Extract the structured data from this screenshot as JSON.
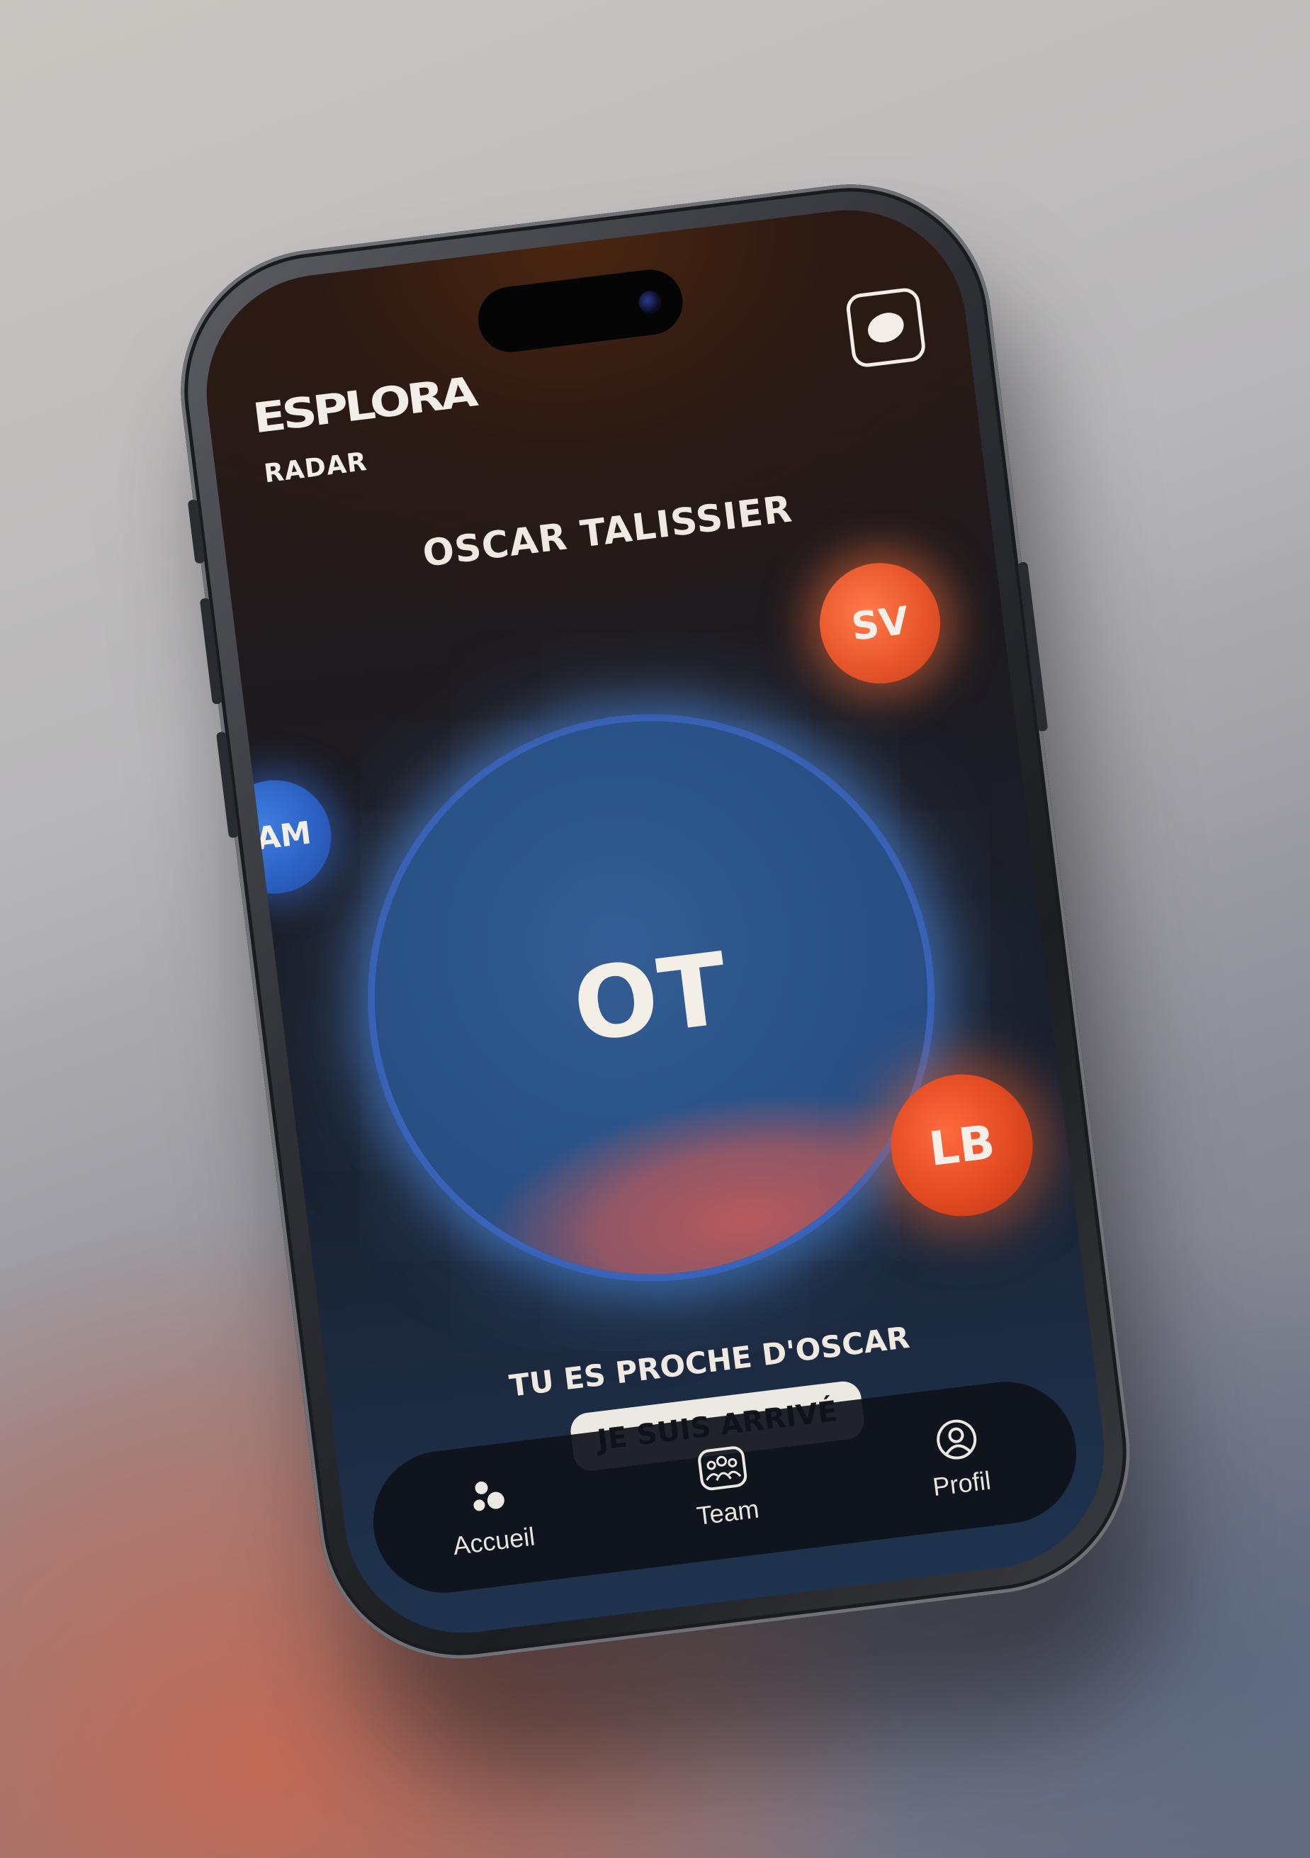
{
  "app": {
    "logo": "ESPLORA",
    "section": "RADAR"
  },
  "radar": {
    "person_name": "OSCAR TALISSIER",
    "center_initials": "OT",
    "nearby": [
      {
        "initials": "SV",
        "color": "#e8562a"
      },
      {
        "initials": "AM",
        "color": "#2b5fc0"
      },
      {
        "initials": "LB",
        "color": "#e24a22"
      }
    ],
    "proximity_text": "TU ES PROCHE D'OSCAR",
    "arrived_button": "JE SUIS ARRIVÉ"
  },
  "top_button": {
    "icon": "blob-icon"
  },
  "tabbar": {
    "items": [
      {
        "label": "Accueil",
        "icon": "dots-cluster-icon",
        "active": true
      },
      {
        "label": "Team",
        "icon": "group-icon",
        "active": false
      },
      {
        "label": "Profil",
        "icon": "user-icon",
        "active": false
      }
    ]
  },
  "colors": {
    "accent_orange": "#e8562a",
    "accent_blue": "#2b5fc0",
    "text_light": "#efe9e2"
  }
}
